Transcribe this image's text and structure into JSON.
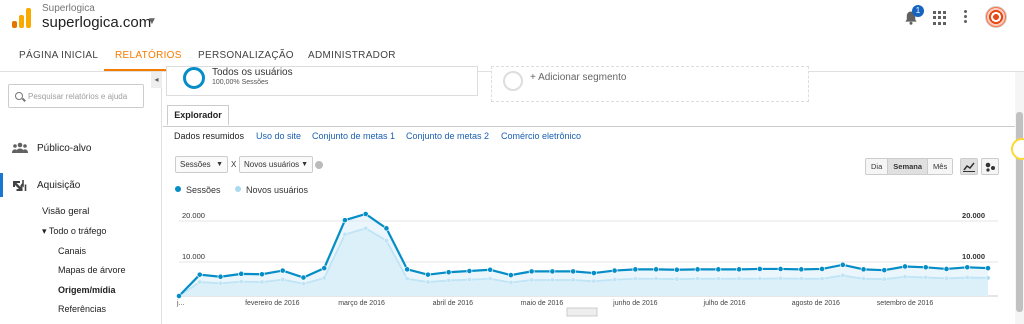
{
  "header": {
    "org": "Superlogica",
    "account": "superlogica.com",
    "notification_count": "1",
    "colors": {
      "logo_orange": "#f9ab00",
      "logo_dark": "#e37400",
      "badge": "#1565c0"
    }
  },
  "nav": {
    "tabs": [
      {
        "label": "PÁGINA INICIAL"
      },
      {
        "label": "RELATÓRIOS",
        "active": true
      },
      {
        "label": "PERSONALIZAÇÃO"
      },
      {
        "label": "ADMINISTRADOR"
      }
    ]
  },
  "sidebar": {
    "search_placeholder": "Pesquisar relatórios e ajuda",
    "items": [
      {
        "label": "Público-alvo",
        "icon": "people-icon"
      },
      {
        "label": "Aquisição",
        "icon": "acquisition-icon",
        "active": true
      },
      {
        "label": "Visão geral"
      },
      {
        "label": "▾ Todo o tráfego"
      },
      {
        "label": "Canais"
      },
      {
        "label": "Mapas de árvore"
      },
      {
        "label": "Origem/mídia",
        "bold": true
      },
      {
        "label": "Referências"
      }
    ]
  },
  "segments": {
    "all_users": {
      "name": "Todos os usuários",
      "detail": "100,00% Sessões"
    },
    "add_label": "+ Adicionar segmento"
  },
  "explorer": {
    "tab_label": "Explorador",
    "subtabs": [
      "Dados resumidos",
      "Uso do site",
      "Conjunto de metas 1",
      "Conjunto de metas 2",
      "Comércio eletrônico"
    ],
    "metric1": "Sessões",
    "vs": "X",
    "metric2": "Novos usuários",
    "periods": [
      "Dia",
      "Semana",
      "Mês"
    ],
    "active_period": "Semana"
  },
  "chart_data": {
    "type": "line",
    "series": [
      {
        "name": "Sessões",
        "color": "#058dc7",
        "values": [
          0,
          5200,
          4700,
          5400,
          5300,
          6200,
          4500,
          6800,
          18500,
          20000,
          16500,
          6500,
          5200,
          5800,
          6100,
          6400,
          5100,
          6000,
          6000,
          6000,
          5600,
          6200,
          6500,
          6500,
          6400,
          6500,
          6500,
          6500,
          6600,
          6600,
          6500,
          6600,
          7600,
          6500,
          6300,
          7200,
          7000,
          6600,
          7000,
          6800
        ]
      },
      {
        "name": "Novos usuários",
        "color": "#a8daf2",
        "values": [
          0,
          3400,
          3100,
          3500,
          3400,
          4000,
          3000,
          4400,
          15000,
          16500,
          13500,
          4200,
          3400,
          3800,
          4000,
          4200,
          3300,
          3900,
          3900,
          3900,
          3600,
          4000,
          4200,
          4200,
          4100,
          4200,
          4200,
          4200,
          4200,
          4300,
          4200,
          4200,
          5000,
          4200,
          4100,
          4700,
          4500,
          4300,
          4500,
          4400
        ]
      }
    ],
    "ylim": [
      0,
      20000
    ],
    "y_ticks": [
      "20.000",
      "10.000"
    ],
    "right_ticks": [
      "20.000",
      "10.000"
    ],
    "x_labels": [
      "j...",
      "fevereiro de 2016",
      "março de 2016",
      "abril de 2016",
      "maio de 2016",
      "junho de 2016",
      "julho de 2016",
      "agosto de 2016",
      "setembro de 2016"
    ],
    "x_label_index": [
      0,
      4.5,
      8.8,
      13.2,
      17.5,
      22,
      26.3,
      30.7,
      35
    ],
    "grid": true,
    "legend_placement": "top-left"
  }
}
